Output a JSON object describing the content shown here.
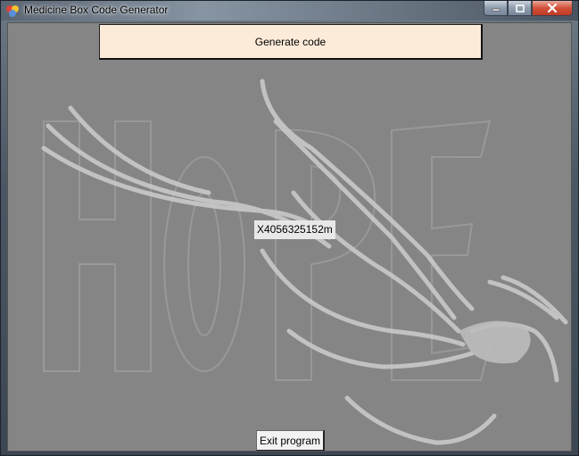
{
  "window": {
    "title": "Medicine Box Code Generator"
  },
  "caption": {
    "minimize_icon": "minimize-icon",
    "maximize_icon": "maximize-icon",
    "close_icon": "close-icon"
  },
  "main": {
    "generate_label": "Generate code",
    "code_value": "X4056325152m",
    "exit_label": "Exit program",
    "background_art_text": "HOPE"
  },
  "colors": {
    "client_background": "#858585",
    "generate_button": "#fdebd9",
    "close_button": "#c03a24"
  }
}
